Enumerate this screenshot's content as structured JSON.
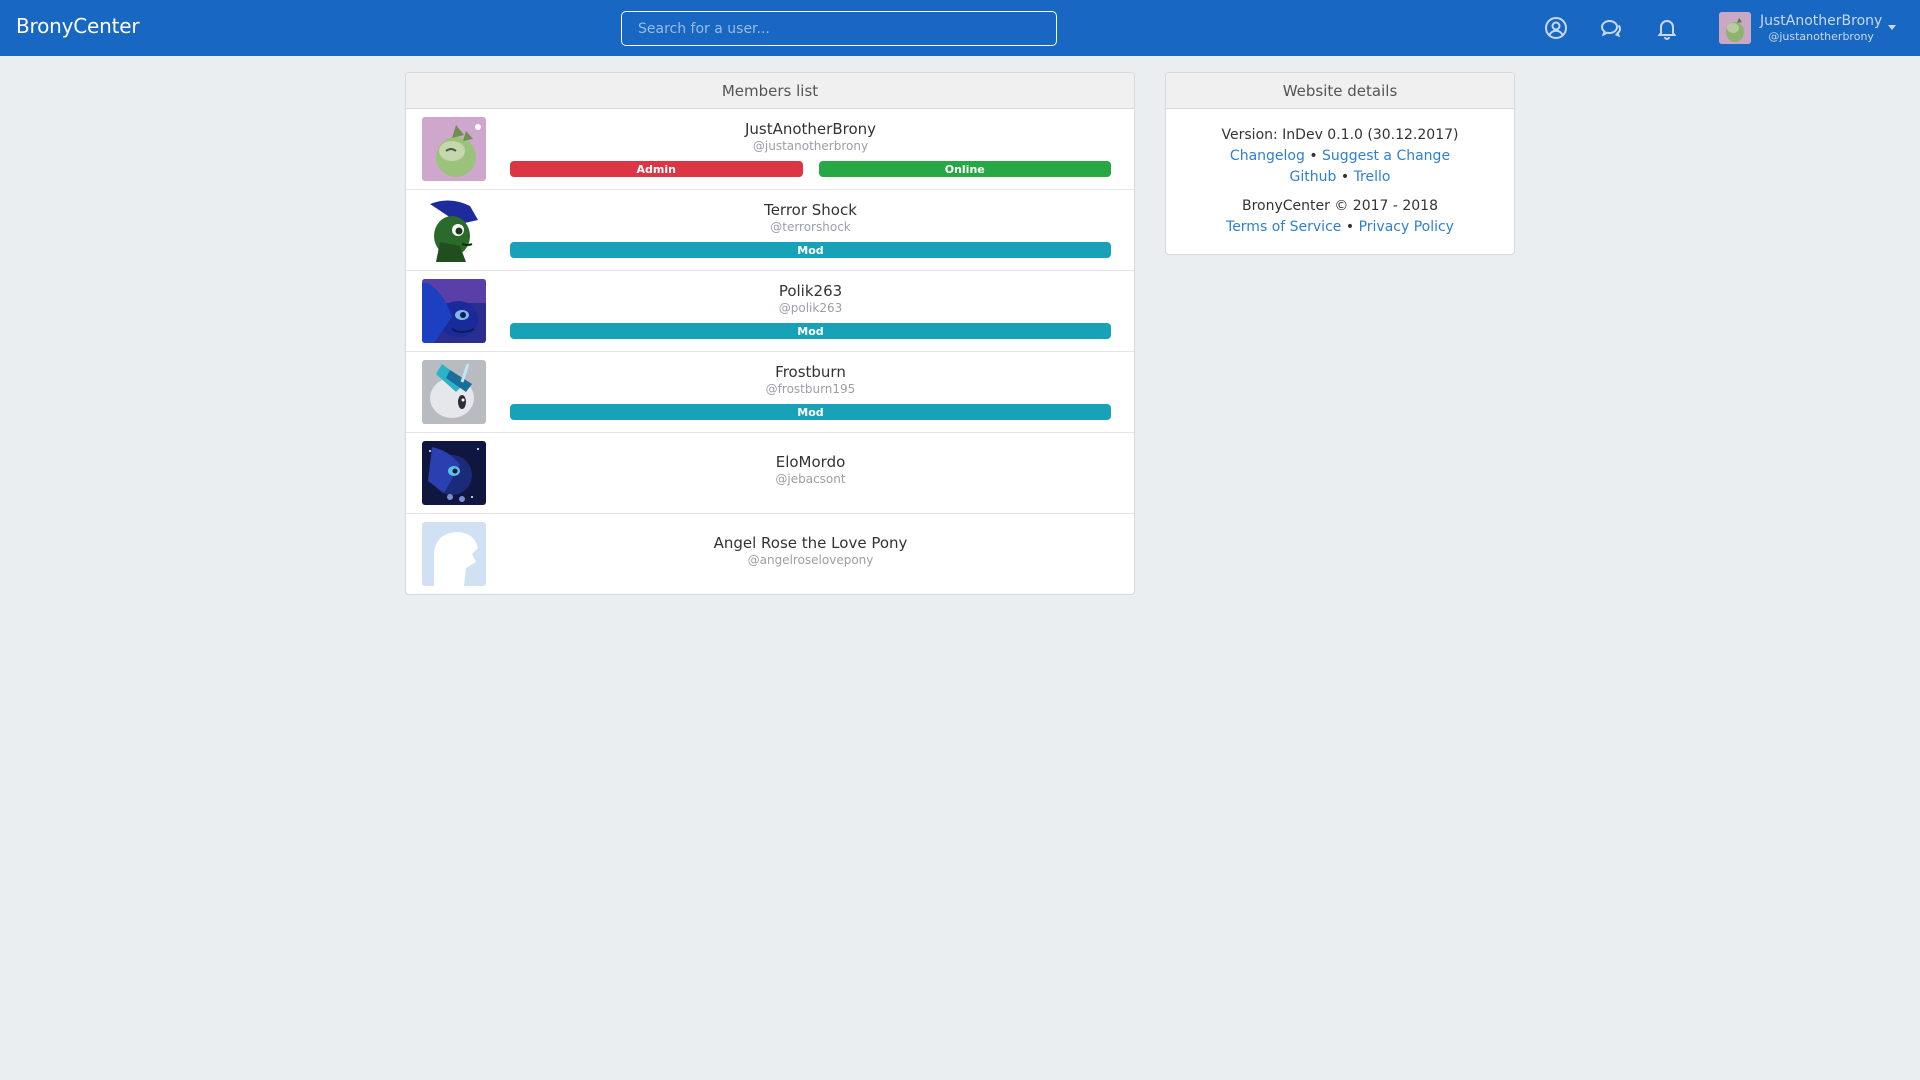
{
  "navbar": {
    "brand": "BronyCenter",
    "search_placeholder": "Search for a user...",
    "icons": [
      "user-circle-icon",
      "chat-bubbles-icon",
      "bell-icon"
    ],
    "user": {
      "name": "JustAnotherBrony",
      "handle": "@justanotherbrony"
    }
  },
  "members": {
    "title": "Members list",
    "items": [
      {
        "name": "JustAnotherBrony",
        "handle": "@justanotherbrony",
        "badges": [
          "Admin",
          "Online"
        ]
      },
      {
        "name": "Terror Shock",
        "handle": "@terrorshock",
        "badges": [
          "Mod"
        ]
      },
      {
        "name": "Polik263",
        "handle": "@polik263",
        "badges": [
          "Mod"
        ]
      },
      {
        "name": "Frostburn",
        "handle": "@frostburn195",
        "badges": [
          "Mod"
        ]
      },
      {
        "name": "EloMordo",
        "handle": "@jebacsont",
        "badges": []
      },
      {
        "name": "Angel Rose the Love Pony",
        "handle": "@angelroselovepony",
        "badges": []
      }
    ]
  },
  "details": {
    "title": "Website details",
    "version": "Version: InDev 0.1.0 (30.12.2017)",
    "links_row1": [
      "Changelog",
      "Suggest a Change"
    ],
    "links_row2": [
      "Github",
      "Trello"
    ],
    "copyright": "BronyCenter © 2017 - 2018",
    "links_row3": [
      "Terms of Service",
      "Privacy Policy"
    ],
    "separator": "•"
  },
  "colors": {
    "navbar": "#1767c3",
    "admin": "#dc3545",
    "online": "#28a745",
    "mod": "#17a2b8",
    "link": "#2f7fd1",
    "background": "#ebeef1"
  }
}
